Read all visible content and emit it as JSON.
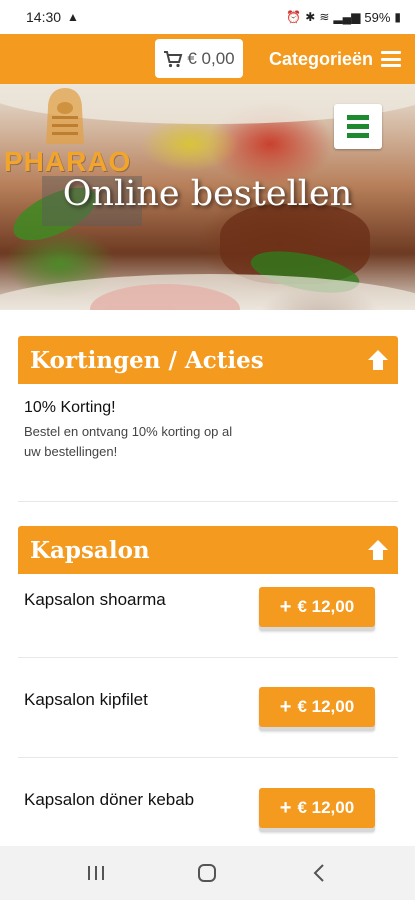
{
  "statusbar": {
    "time": "14:30",
    "battery": "59%"
  },
  "header": {
    "cart_total": "€ 0,00",
    "categories_label": "Categorieën"
  },
  "hero": {
    "logo_text": "PHARAO",
    "title": "Online bestellen"
  },
  "sections": [
    {
      "title": "Kortingen / Acties",
      "promo": {
        "title": "10% Korting!",
        "description": "Bestel en ontvang 10% korting op al uw bestellingen!"
      }
    },
    {
      "title": "Kapsalon",
      "items": [
        {
          "name": "Kapsalon shoarma",
          "price": "€ 12,00"
        },
        {
          "name": "Kapsalon kipfilet",
          "price": "€ 12,00"
        },
        {
          "name": "Kapsalon döner kebab",
          "price": "€ 12,00"
        }
      ]
    }
  ],
  "colors": {
    "accent": "#f49a1e",
    "menu_green": "#1e8a2f",
    "nav_bg": "#f2f2f2"
  },
  "icons": {
    "cart": "cart-icon",
    "hamburger": "hamburger-icon",
    "collapse": "arrow-up-icon"
  }
}
